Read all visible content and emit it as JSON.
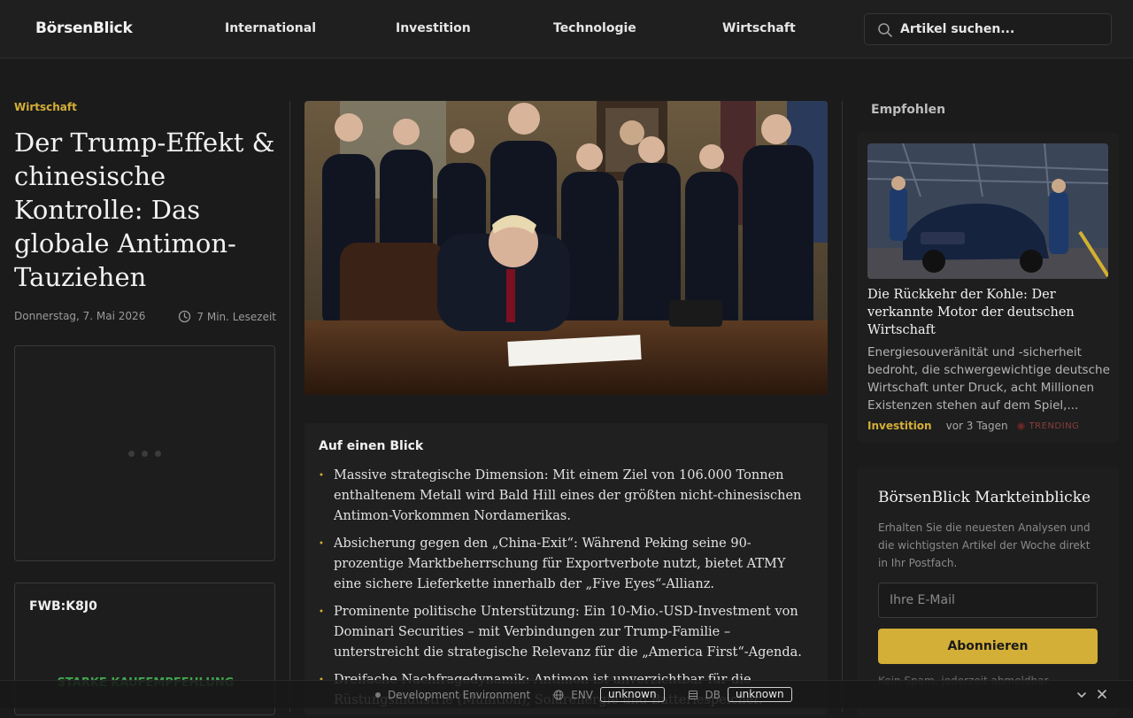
{
  "header": {
    "logo": "BörsenBlick",
    "nav": [
      "International",
      "Investition",
      "Technologie",
      "Wirtschaft"
    ],
    "search_placeholder": "Artikel suchen..."
  },
  "article": {
    "category": "Wirtschaft",
    "title": "Der Trump-Effekt & chinesische Kontrolle: Das globale Antimon-Tauziehen",
    "date": "Donnerstag, 7. Mai 2026",
    "read_time": "7 Min. Lesezeit",
    "ticker": "FWB:K8J0",
    "rating": "STARKE KAUFEMPFEHLUNG"
  },
  "glance": {
    "title": "Auf einen Blick",
    "items": [
      "Massive strategische Dimension: Mit einem Ziel von 106.000 Tonnen enthaltenem Metall wird Bald Hill eines der größten nicht-chinesischen Antimon-Vorkommen Nordamerikas.",
      "Absicherung gegen den „China-Exit“: Während Peking seine 90-prozentige Marktbeherrschung für Exportverbote nutzt, bietet ATMY eine sichere Lieferkette innerhalb der „Five Eyes“-Allianz.",
      "Prominente politische Unterstützung: Ein 10-Mio.-USD-Investment von Dominari Securities – mit Verbindungen zur Trump-Familie – unterstreicht die strategische Relevanz für die „America First“-Agenda.",
      "Dreifache Nachfragedynamik: Antimon ist unverzichtbar für die Rüstungsindustrie (Munition), Solarenergie und Batteriespeicher."
    ]
  },
  "recommended": {
    "heading": "Empfohlen",
    "title": "Die Rückkehr der Kohle: Der verkannte Motor der deutschen Wirtschaft",
    "excerpt": "Energiesouveränität und -sicherheit bedroht, die schwergewichtige deutsche Wirtschaft unter Druck, acht Millionen Existenzen stehen auf dem Spiel,...",
    "category": "Investition",
    "time": "vor 3 Tagen",
    "badge": "TRENDING"
  },
  "newsletter": {
    "title": "BörsenBlick Markteinblicke",
    "text": "Erhalten Sie die neuesten Analysen und die wichtigsten Artikel der Woche direkt in Ihr Postfach.",
    "email_placeholder": "Ihre E-Mail",
    "button": "Abonnieren",
    "footnote": "Kein Spam, jederzeit abmeldbar."
  },
  "devbar": {
    "label": "Development Environment",
    "env_label": "ENV",
    "env_value": "unknown",
    "db_label": "DB",
    "db_value": "unknown"
  },
  "colors": {
    "accent": "#d4af37",
    "background": "#1b1b1b",
    "positive": "#3fa34d"
  }
}
